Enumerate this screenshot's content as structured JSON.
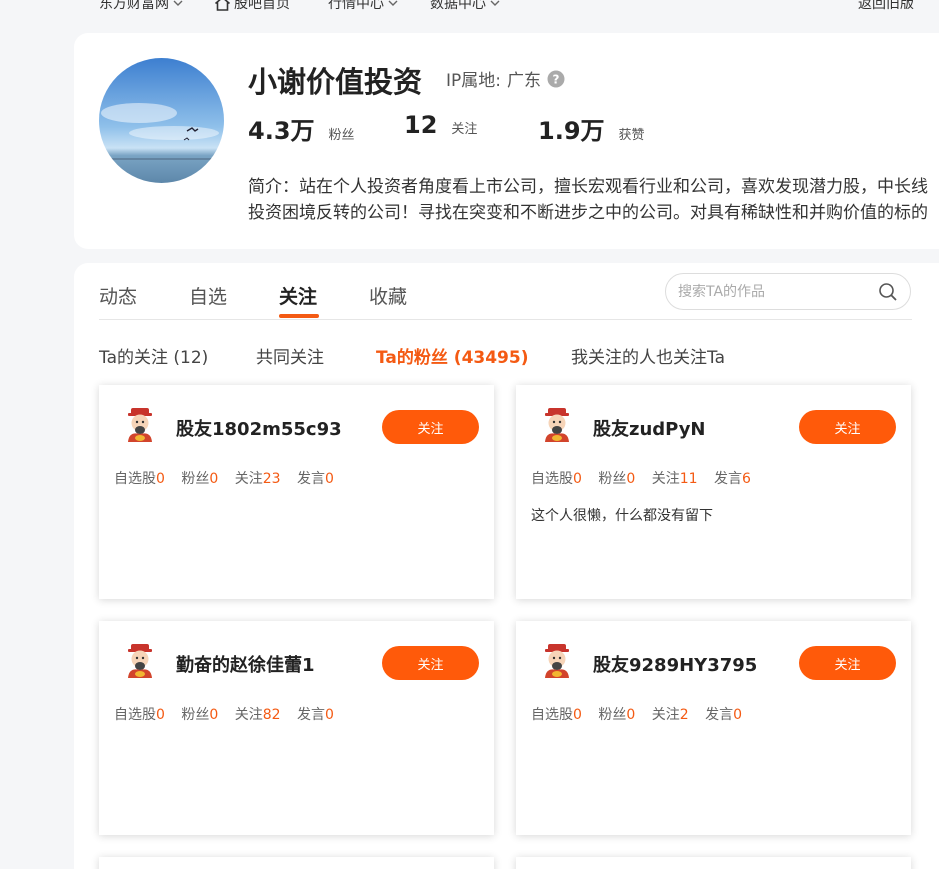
{
  "nav": {
    "items": [
      {
        "label": "东方财富网",
        "has_chevron": true
      },
      {
        "label": "股吧首页",
        "has_chevron": false
      },
      {
        "label": "行情中心",
        "has_chevron": true
      },
      {
        "label": "数据中心",
        "has_chevron": true
      }
    ],
    "back_label": "返回旧版"
  },
  "profile": {
    "name": "小谢价值投资",
    "ip_label": "IP属地:",
    "ip_value": "广东",
    "stats": [
      {
        "value": "4.3万",
        "label": "粉丝"
      },
      {
        "value": "12",
        "label": "关注"
      },
      {
        "value": "1.9万",
        "label": "获赞"
      }
    ],
    "bio_lines": [
      "简介：站在个人投资者角度看上市公司，擅长宏观看行业和公司，喜欢发现潜力股，中长线",
      "投资困境反转的公司！寻找在突变和不断进步之中的公司。对具有稀缺性和并购价值的标的"
    ]
  },
  "tabs": [
    {
      "label": "动态",
      "active": false
    },
    {
      "label": "自选",
      "active": false
    },
    {
      "label": "关注",
      "active": true
    },
    {
      "label": "收藏",
      "active": false
    }
  ],
  "search": {
    "placeholder": "搜索TA的作品"
  },
  "subtabs": [
    {
      "label": "Ta的关注 (12)",
      "active": false
    },
    {
      "label": "共同关注",
      "active": false
    },
    {
      "label": "Ta的粉丝 (43495)",
      "active": true
    },
    {
      "label": "我关注的人也关注Ta",
      "active": false
    }
  ],
  "stat_labels": [
    "自选股",
    "粉丝",
    "关注",
    "发言"
  ],
  "follow_label": "关注",
  "users": [
    {
      "name": "股友1802m55c93",
      "stats": [
        "0",
        "0",
        "23",
        "0"
      ],
      "desc": ""
    },
    {
      "name": "股友zudPyN",
      "stats": [
        "0",
        "0",
        "11",
        "6"
      ],
      "desc": "这个人很懒，什么都没有留下"
    },
    {
      "name": "勤奋的赵徐佳蕾1",
      "stats": [
        "0",
        "0",
        "82",
        "0"
      ],
      "desc": ""
    },
    {
      "name": "股友9289HY3795",
      "stats": [
        "0",
        "0",
        "2",
        "0"
      ],
      "desc": ""
    }
  ],
  "colors": {
    "accent": "#f45a13",
    "button": "#ff5a0a"
  }
}
